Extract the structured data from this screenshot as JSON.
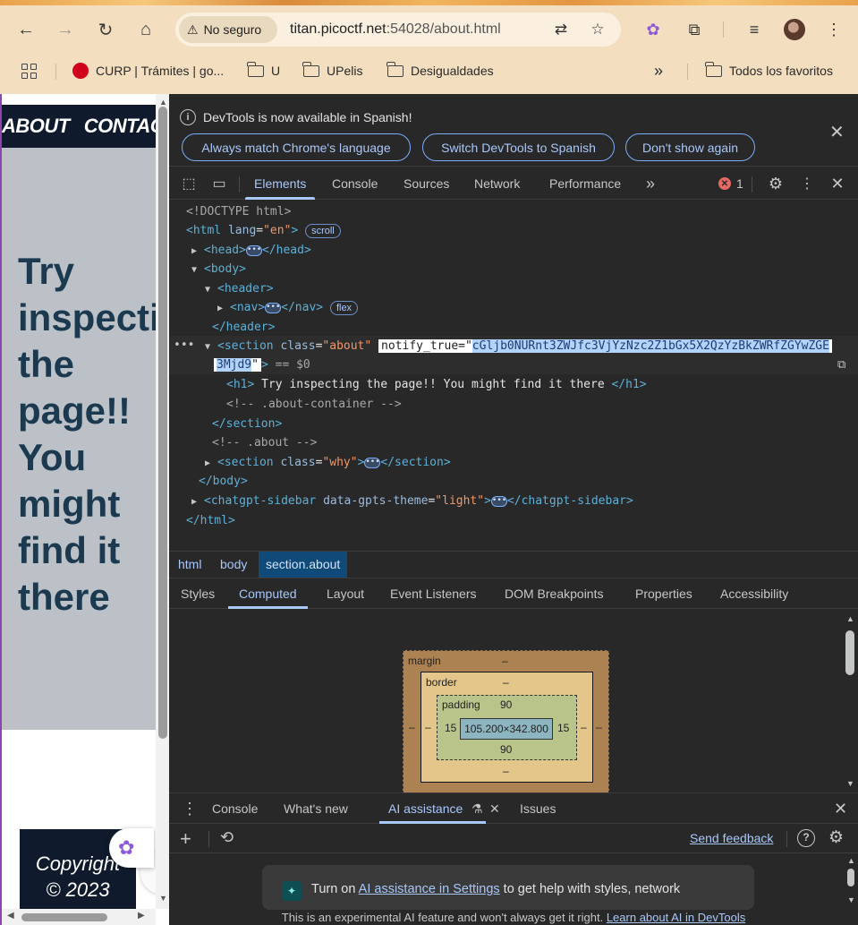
{
  "browser": {
    "security_label": "No seguro",
    "url_host": "titan.picoctf.net",
    "url_rest": ":54028/about.html",
    "bookmarks": [
      {
        "label": "CURP | Trámites | go..."
      },
      {
        "label": "U"
      },
      {
        "label": "UPelis"
      },
      {
        "label": "Desigualdades"
      }
    ],
    "overflow_label": "»",
    "all_bookmarks": "Todos los favoritos"
  },
  "page": {
    "nav": [
      "ABOUT",
      "CONTACT"
    ],
    "hero": "Try inspecting the page!! You might find it there",
    "footer_line1": "Copyright",
    "footer_line2": "© 2023"
  },
  "devtools": {
    "info_message": "DevTools is now available in Spanish!",
    "info_buttons": [
      "Always match Chrome's language",
      "Switch DevTools to Spanish",
      "Don't show again"
    ],
    "tabs": [
      "Elements",
      "Console",
      "Sources",
      "Network",
      "Performance"
    ],
    "active_tab": "Elements",
    "error_count": "1",
    "dom": {
      "doctype": "<!DOCTYPE html>",
      "html_open_tag": "<html",
      "html_lang_attr": "lang",
      "html_lang_value": "\"en\"",
      "scroll_badge": "scroll",
      "head": "head",
      "body": "body",
      "header": "header",
      "nav": "nav",
      "flex_badge": "flex",
      "section": "section",
      "section_class_attr": "class",
      "section_class_value": "\"about\"",
      "edit_attr_name": "notify_true",
      "edit_value_part1": "cGljb0NURnt3ZWJfc3VjYzNzc2Z1bGx5X2QzYzBkZWRfZGYwZGE",
      "edit_value_part2": "3Mjd9",
      "dollar_ref": " == $0",
      "h1_text": " Try inspecting the page!! You might find it there ",
      "comment_about_container": "<!-- .about-container -->",
      "section_close": "section",
      "comment_about": "<!-- .about -->",
      "why_class_value": "\"why\"",
      "body_close": "body",
      "sidebar_tag": "chatgpt-sidebar",
      "sidebar_attr": "data-gpts-theme",
      "sidebar_attr_value": "\"light\"",
      "html_close": "html"
    },
    "breadcrumbs": [
      "html",
      "body",
      "section.about"
    ],
    "subtabs": [
      "Styles",
      "Computed",
      "Layout",
      "Event Listeners",
      "DOM Breakpoints",
      "Properties",
      "Accessibility"
    ],
    "active_subtab": "Computed",
    "box_model": {
      "margin_label": "margin",
      "margin_top": "–",
      "margin_left": "–",
      "margin_right": "–",
      "border_label": "border",
      "border_top": "–",
      "border_bottom": "–",
      "border_left": "–",
      "border_right": "–",
      "padding_label": "padding",
      "padding_top": "90",
      "padding_bottom": "90",
      "padding_left": "15",
      "padding_right": "15",
      "content": "105.200×342.800"
    },
    "drawer": {
      "tabs": [
        "Console",
        "What's new",
        "AI assistance",
        "Issues"
      ],
      "active_tab": "AI assistance",
      "send_feedback": "Send feedback",
      "card_prefix": "Turn on ",
      "card_link": "AI assistance in Settings",
      "card_suffix": " to get help with styles, network",
      "disclaimer": "This is an experimental AI feature and won't always get it right. ",
      "disclaimer_link": "Learn about AI in DevTools"
    }
  },
  "colors": {
    "devtools_bg": "#282828",
    "accent": "#a8c7fa",
    "tag": "#5db0d7",
    "attr_value": "#f29766",
    "page_hero": "#1b3a4f"
  }
}
